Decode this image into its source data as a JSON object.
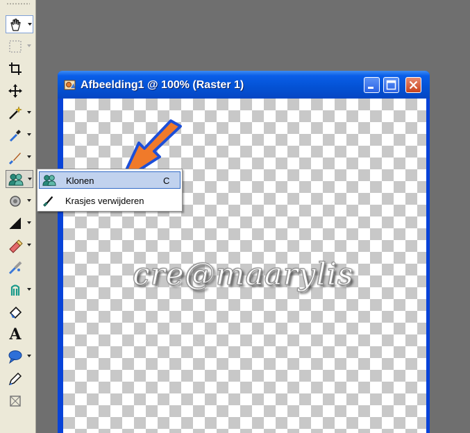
{
  "window": {
    "title": "Afbeelding1 @ 100% (Raster 1)",
    "watermark": "cre@maarylis"
  },
  "toolbar": {
    "tools": [
      {
        "icon": "pan-hand-icon",
        "has_dropdown": true,
        "state": "active"
      },
      {
        "icon": "selection-marquee-icon",
        "has_dropdown": true,
        "state": "disabled"
      },
      {
        "icon": "crop-icon",
        "has_dropdown": false
      },
      {
        "icon": "move-icon",
        "has_dropdown": false
      },
      {
        "icon": "magic-wand-icon",
        "has_dropdown": true
      },
      {
        "icon": "dropper-icon",
        "has_dropdown": true
      },
      {
        "icon": "paint-brush-icon",
        "has_dropdown": true
      },
      {
        "icon": "clone-brush-icon",
        "has_dropdown": true,
        "state": "pressed"
      },
      {
        "icon": "dodge-icon",
        "has_dropdown": true
      },
      {
        "icon": "contrast-icon",
        "has_dropdown": true
      },
      {
        "icon": "eraser-icon",
        "has_dropdown": true
      },
      {
        "icon": "picture-tube-icon",
        "has_dropdown": false
      },
      {
        "icon": "stamp-icon",
        "has_dropdown": true
      },
      {
        "icon": "fill-icon",
        "has_dropdown": false
      },
      {
        "icon": "text-icon",
        "label": "A",
        "has_dropdown": false
      },
      {
        "icon": "speech-bubble-icon",
        "has_dropdown": true
      },
      {
        "icon": "pen-icon",
        "has_dropdown": false
      },
      {
        "icon": "deform-icon",
        "has_dropdown": false
      }
    ]
  },
  "menu": {
    "items": [
      {
        "label": "Klonen",
        "shortcut": "C",
        "icon": "clone-brush-icon",
        "highlighted": true
      },
      {
        "label": "Krasjes verwijderen",
        "shortcut": "",
        "icon": "scratch-remover-icon",
        "highlighted": false
      }
    ]
  },
  "colors": {
    "titlebar": "#0453d6",
    "menu_highlight": "#c1d2ee",
    "arrow": "#f07a2a",
    "arrow_outline": "#1d4fd8"
  }
}
